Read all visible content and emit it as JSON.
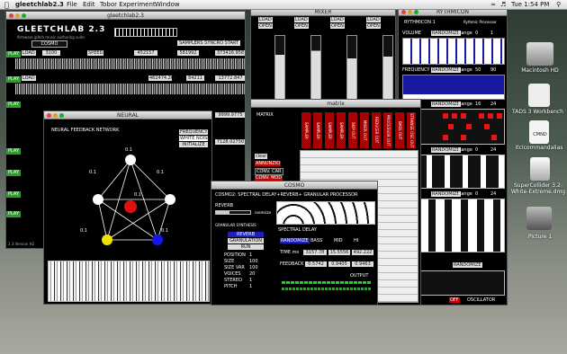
{
  "menubar": {
    "app": "gleetchlab2.3",
    "items": [
      "File",
      "Edit",
      "Tobor Experiment",
      "Window"
    ],
    "clock": "Tue 1:54 PM"
  },
  "main": {
    "title": "gleetchlab2.3",
    "logo": "GLEETCHLAB 2.3",
    "tagline": "firmware glitch music authoring suite",
    "select": "COSMO",
    "samplers_btn": "SAMPLERS SYNCRO START",
    "version": "2.3 Version H2",
    "tracks": [
      {
        "play": "PLAY",
        "load": "LOAD",
        "speed": "SPEED",
        "v1": "3100",
        "v2": "452157",
        "v3": "581992",
        "v4": "373416.958"
      },
      {
        "play": "PLAY",
        "load": "LOAD",
        "v1": "",
        "v2": "462474.262",
        "v3": "84211",
        "v4": "13772.847"
      },
      {
        "play": "PLAY",
        "load": "LOAD",
        "v1": "",
        "v2": "",
        "v3": "",
        "v4": "7128.02750"
      },
      {
        "play": "PLAY",
        "load": "LOAD",
        "v1": "",
        "v2": "",
        "v3": "",
        "v4": "9999.9775"
      }
    ]
  },
  "mixer": {
    "title": "MIXER",
    "labels": [
      "LOAD",
      "OPEN",
      "LOAD",
      "OPEN",
      "LOAD",
      "OPEN",
      "LOAD",
      "OPEN"
    ],
    "levels": [
      0.75,
      0.8,
      0.7,
      0.72
    ]
  },
  "rythmicon": {
    "title": "RYTHMICON",
    "inner_title": "RYTHMICON 1",
    "subtitle": "Rythmic Processor",
    "rows": [
      {
        "label": "VOLUME",
        "randomize": "RANDOMIZE",
        "range_label": "Range",
        "range": "0",
        "x": "1"
      },
      {
        "label": "FREQUENCY",
        "randomize": "RANDOMIZE",
        "range_label": "Range",
        "range": "50",
        "x": "90"
      },
      {
        "label": "",
        "randomize": "RANDOMIZE",
        "range_label": "Range",
        "range": "16",
        "x": "24"
      },
      {
        "label": "",
        "randomize": "RANDOMIZE",
        "range_label": "Range",
        "range": "0",
        "x": "24"
      },
      {
        "label": "",
        "randomize": "RANDOMIZE",
        "range_label": "Range",
        "range": "0",
        "x": "24"
      }
    ],
    "bottom": {
      "randomize": "RANDOMIZE",
      "off": "OFF",
      "oscillator": "OSCILLATOR"
    }
  },
  "matrix": {
    "title": "matrix",
    "label": "MATRIX",
    "cols": [
      "SAMPLER",
      "SAMPLER",
      "SAMPLER",
      "SAMPLER",
      "SKIP OUT",
      "MIXER OUT",
      "REDUCER OUT",
      "PROCESSOR OUT",
      "BASS OUT",
      "STRANGE OSC OUT"
    ],
    "rows": [
      "clear",
      "ANNUNZIO",
      "CONV. CAR",
      "CONV. MOD"
    ]
  },
  "neural": {
    "title": "NEURAL",
    "header": "NEURAL FEEDBACK NETWORK",
    "options": [
      "FREQUENCY",
      "WHITE NOISE",
      "INITIALIZE"
    ],
    "weights": [
      "0.1",
      "0.1",
      "0.1",
      "0.1",
      "0.1",
      "0.1"
    ]
  },
  "cosmo": {
    "title": "COSMO",
    "header": "COSMO2: SPECTRAL DELAY+REVERB+ GRANULAR PROCESSOR",
    "reverb": "REVERB",
    "roomsize": "roomsize",
    "granular": "GRANULAR SYNTHESIS",
    "modes": [
      "REVERB",
      "GRANULATION",
      "RUN"
    ],
    "params": [
      {
        "k": "POSITION",
        "v": "1"
      },
      {
        "k": "SIZE",
        "v": "100"
      },
      {
        "k": "SIZE VAR",
        "v": "100"
      },
      {
        "k": "VOICES",
        "v": "20"
      },
      {
        "k": "STEREO",
        "v": "1"
      },
      {
        "k": "PITCH",
        "v": "1"
      }
    ],
    "spectral": "SPECTRAL DELAY",
    "randomize": "RANDOMIZE",
    "bands": [
      "BASS",
      "MID",
      "HI"
    ],
    "time_label": "TIME ms",
    "time": [
      "3157.78",
      "15.5556",
      "492.222"
    ],
    "feedback_label": "FEEDBACK",
    "feedback": [
      "0.5742",
      "0.9405",
      "0.9463"
    ],
    "output": "OUTPUT"
  },
  "desktop_icons": [
    {
      "label": "Macintosh HD"
    },
    {
      "label": "TADS 3 Workbench"
    },
    {
      "label": "CMND"
    },
    {
      "label": "itclcommandalias"
    },
    {
      "label": "SuperCollider 3.2-White-Extreme.dmg"
    },
    {
      "label": "Picture 1"
    }
  ]
}
